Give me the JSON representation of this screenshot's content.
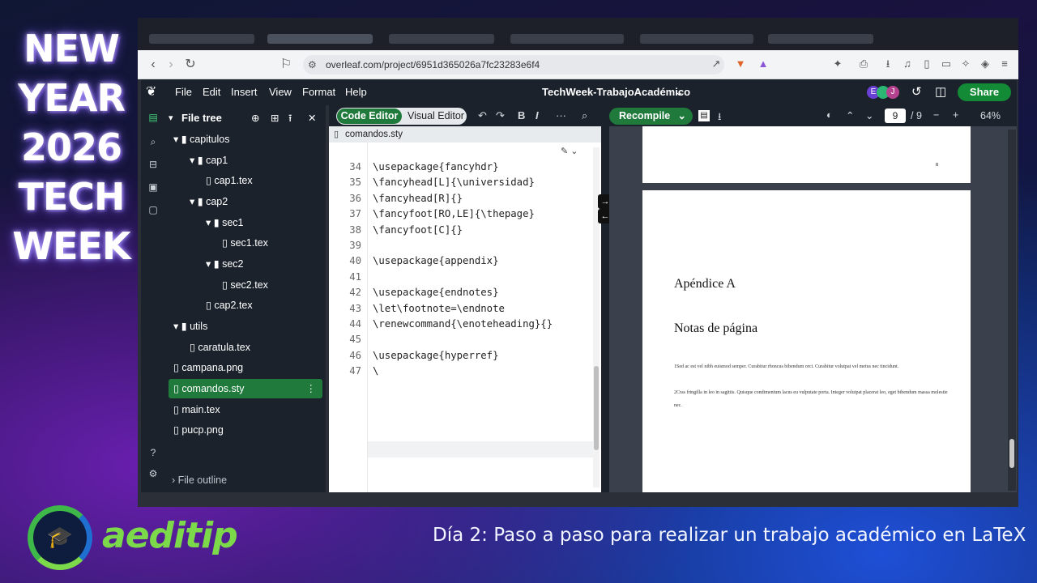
{
  "overlay": {
    "title_lines": [
      "NEW",
      "YEAR",
      "2026",
      "TECH",
      "WEEK"
    ],
    "brand": "aeditip",
    "caption": "Día 2: Paso a paso para realizar un trabajo académico en LaTeX"
  },
  "browser": {
    "url": "overleaf.com/project/6951d365026a7fc23283e6f4"
  },
  "overleaf": {
    "menu": [
      "File",
      "Edit",
      "Insert",
      "View",
      "Format",
      "Help"
    ],
    "project_title": "TechWeek-TrabajoAcadémico",
    "avatars": [
      "E",
      "J"
    ],
    "share_label": "Share"
  },
  "file_tree": {
    "header": "File tree",
    "items": [
      {
        "label": "capitulos",
        "type": "folder"
      },
      {
        "label": "cap1",
        "type": "folder"
      },
      {
        "label": "cap1.tex",
        "type": "file"
      },
      {
        "label": "cap2",
        "type": "folder"
      },
      {
        "label": "sec1",
        "type": "folder"
      },
      {
        "label": "sec1.tex",
        "type": "file"
      },
      {
        "label": "sec2",
        "type": "folder"
      },
      {
        "label": "sec2.tex",
        "type": "file"
      },
      {
        "label": "cap2.tex",
        "type": "file"
      },
      {
        "label": "utils",
        "type": "folder"
      },
      {
        "label": "caratula.tex",
        "type": "file"
      },
      {
        "label": "campana.png",
        "type": "file"
      },
      {
        "label": "comandos.sty",
        "type": "file",
        "selected": true
      },
      {
        "label": "main.tex",
        "type": "file"
      },
      {
        "label": "pucp.png",
        "type": "file"
      }
    ],
    "outline_label": "File outline"
  },
  "editor": {
    "code_editor_label": "Code Editor",
    "visual_editor_label": "Visual Editor",
    "open_file": "comandos.sty",
    "lines": [
      {
        "n": "34",
        "text": "\\usepackage{fancyhdr}"
      },
      {
        "n": "35",
        "text": "\\fancyhead[L]{\\universidad}"
      },
      {
        "n": "36",
        "text": "\\fancyhead[R]{}"
      },
      {
        "n": "37",
        "text": "\\fancyfoot[RO,LE]{\\thepage}"
      },
      {
        "n": "38",
        "text": "\\fancyfoot[C]{}"
      },
      {
        "n": "39",
        "text": ""
      },
      {
        "n": "40",
        "text": "\\usepackage{appendix}"
      },
      {
        "n": "41",
        "text": ""
      },
      {
        "n": "42",
        "text": "\\usepackage{endnotes}"
      },
      {
        "n": "43",
        "text": "\\let\\footnote=\\endnote"
      },
      {
        "n": "44",
        "text": "\\renewcommand{\\enoteheading}{}"
      },
      {
        "n": "45",
        "text": ""
      },
      {
        "n": "46",
        "text": "\\usepackage{hyperref}"
      },
      {
        "n": "47",
        "text": "\\"
      }
    ]
  },
  "pdf": {
    "recompile_label": "Recompile",
    "page_current": "9",
    "page_total": "/ 9",
    "zoom": "64%",
    "prev_page_number": "8",
    "heading1": "Apéndice A",
    "heading2": "Notas de página",
    "notes": [
      "1Sed ac est vel nibh euismod semper. Curabitur rhoncus bibendum orci. Curabitur volutpat vel metus nec tincidunt.",
      "2Cras fringilla in leo in sagittis. Quisque condimentum lacus eu vulputate porta. Integer volutpat placerat leo, eget bibendum massa molestie nec."
    ]
  }
}
